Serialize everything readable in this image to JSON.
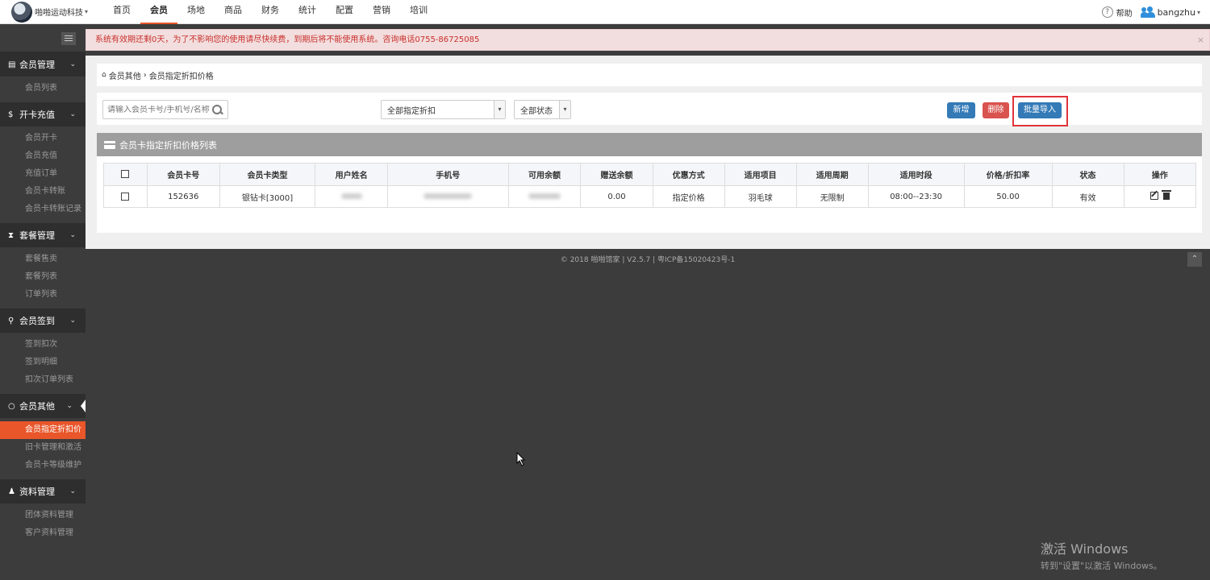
{
  "topbar": {
    "brand": "啪啪运动科技",
    "nav": [
      "首页",
      "会员",
      "场地",
      "商品",
      "财务",
      "统计",
      "配置",
      "营销",
      "培训"
    ],
    "active_nav": "会员",
    "help_label": "帮助",
    "username": "bangzhu"
  },
  "sidebar": {
    "sections": [
      {
        "title": "会员管理",
        "icon": "id-card-icon",
        "items": [
          "会员列表"
        ]
      },
      {
        "title": "开卡充值",
        "icon": "dollar-icon",
        "items": [
          "会员开卡",
          "会员充值",
          "充值订单",
          "会员卡转账",
          "会员卡转账记录"
        ]
      },
      {
        "title": "套餐管理",
        "icon": "hourglass-icon",
        "items": [
          "套餐售卖",
          "套餐列表",
          "订单列表"
        ]
      },
      {
        "title": "会员签到",
        "icon": "map-pin-icon",
        "items": [
          "签到扣次",
          "签到明细",
          "扣次订单列表"
        ]
      },
      {
        "title": "会员其他",
        "icon": "circle-icon",
        "items": [
          "会员指定折扣价",
          "旧卡管理和激活",
          "会员卡等级维护"
        ]
      },
      {
        "title": "资料管理",
        "icon": "users-icon",
        "items": [
          "团体资料管理",
          "客户资料管理"
        ]
      }
    ],
    "active_item": "会员指定折扣价"
  },
  "alert": {
    "text": "系统有效期还剩0天，为了不影响您的使用请尽快续费，到期后将不能使用系统。咨询电话0755-86725085",
    "close": "×"
  },
  "breadcrumb": {
    "parent": "会员其他",
    "separator": "›",
    "current": "会员指定折扣价格"
  },
  "filters": {
    "search_placeholder": "请输入会员卡号/手机号/名称",
    "discount_select": "全部指定折扣",
    "status_select": "全部状态"
  },
  "buttons": {
    "add": "新增",
    "delete": "删除",
    "import": "批量导入"
  },
  "panel": {
    "title": "会员卡指定折扣价格列表"
  },
  "table": {
    "headers": [
      "",
      "会员卡号",
      "会员卡类型",
      "用户姓名",
      "手机号",
      "可用余额",
      "赠送余额",
      "优惠方式",
      "适用项目",
      "适用周期",
      "适用时段",
      "价格/折扣率",
      "状态",
      "操作"
    ],
    "rows": [
      {
        "card_no": "152636",
        "card_type": "银钻卡[3000]",
        "gift_balance": "0.00",
        "discount_mode": "指定价格",
        "project": "羽毛球",
        "cycle": "无限制",
        "time_range": "08:00--23:30",
        "price": "50.00",
        "status": "有效"
      }
    ]
  },
  "footer": {
    "text": "© 2018 啪啪馆家 | V2.5.7 | 粤ICP备15020423号-1"
  },
  "watermark": {
    "line1": "激活 Windows",
    "line2": "转到\"设置\"以激活 Windows。"
  }
}
